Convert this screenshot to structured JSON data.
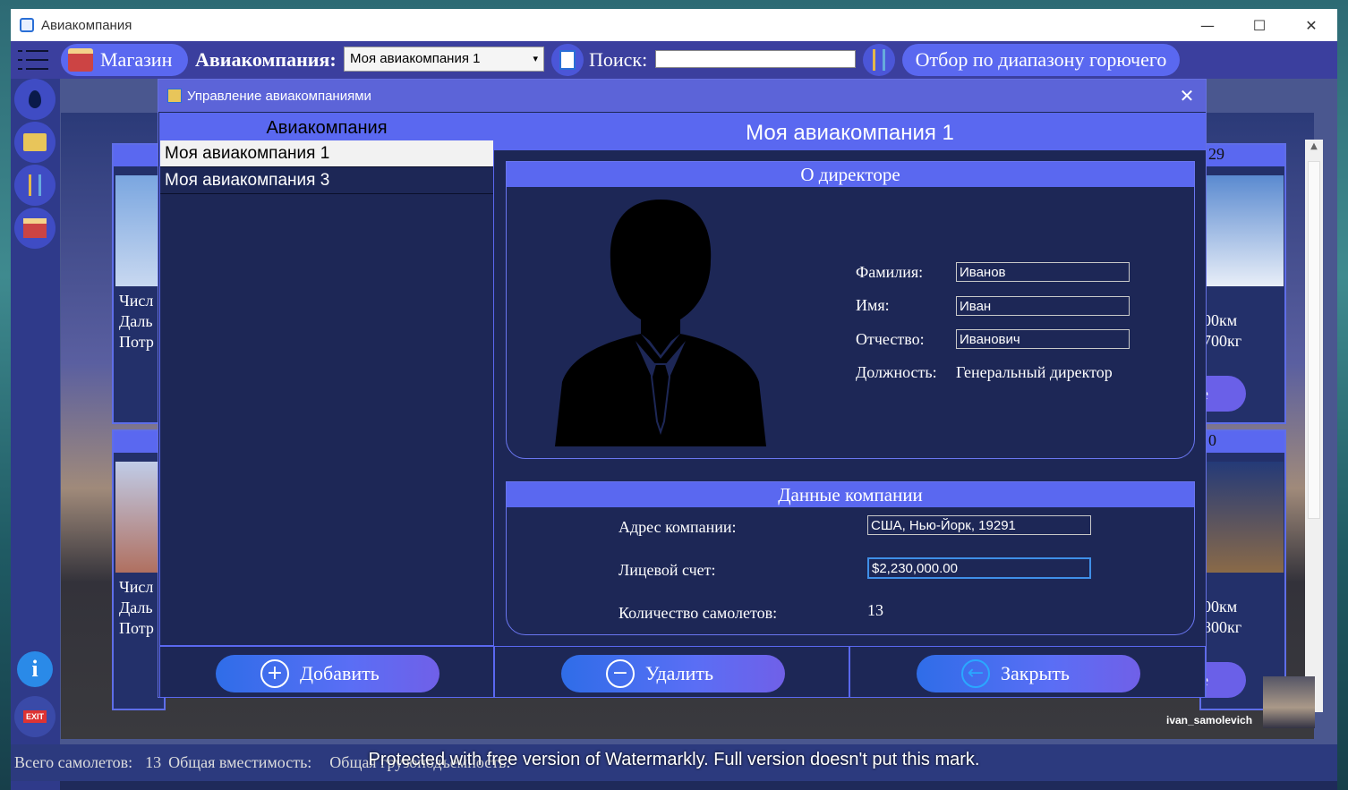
{
  "window": {
    "title": "Авиакомпания",
    "controls": {
      "minimize": "—",
      "maximize": "☐",
      "close": "✕"
    }
  },
  "toolbar": {
    "shop_label": "Магазин",
    "airline_label": "Авиакомпания:",
    "airline_selected": "Моя авиакомпания 1",
    "search_label": "Поиск:",
    "search_value": "",
    "fuel_filter_label": "Отбор по диапазону горючего"
  },
  "background_cards": {
    "card1_head_right": "29",
    "card2_head_right": "0",
    "left_lines": [
      "Числ",
      "Даль",
      "Потр"
    ],
    "right_lines_top": [
      "00км",
      "700кг"
    ],
    "right_lines_bottom": [
      "00км",
      "800кг"
    ],
    "right_btn_fragment": "е"
  },
  "statusbar": {
    "total_planes_label": "Всего самолетов:",
    "total_planes_value": "13",
    "capacity_label": "Общая вместимость:",
    "cargo_label": "Общая грузоподъемность:"
  },
  "watermark": "Protected with free version of Watermarkly. Full version doesn't put this mark.",
  "user": {
    "name": "ivan_samolevich"
  },
  "dialog": {
    "title": "Управление авиакомпаниями",
    "close": "✕",
    "list_header": "Авиакомпания",
    "companies": [
      "Моя авиакомпания 1",
      "Моя авиакомпания 3"
    ],
    "selected_company": "Моя авиакомпания 1",
    "director": {
      "section_title": "О директоре",
      "last_name_label": "Фамилия:",
      "last_name": "Иванов",
      "first_name_label": "Имя:",
      "first_name": "Иван",
      "patronymic_label": "Отчество:",
      "patronymic": "Иванович",
      "position_label": "Должность:",
      "position": "Генеральный директор"
    },
    "company": {
      "section_title": "Данные компании",
      "address_label": "Адрес компании:",
      "address": "США, Нью-Йорк, 19291",
      "account_label": "Лицевой счет:",
      "account": "$2,230,000.00",
      "planes_label": "Количество самолетов:",
      "planes": "13"
    },
    "buttons": {
      "add": "Добавить",
      "delete": "Удалить",
      "close": "Закрыть"
    },
    "button_icons": {
      "add": "+",
      "delete": "−",
      "close": "←"
    }
  },
  "colors": {
    "accent": "#5a68f0",
    "panel": "#1d2756",
    "button_gradient_start": "#2f6de8"
  }
}
